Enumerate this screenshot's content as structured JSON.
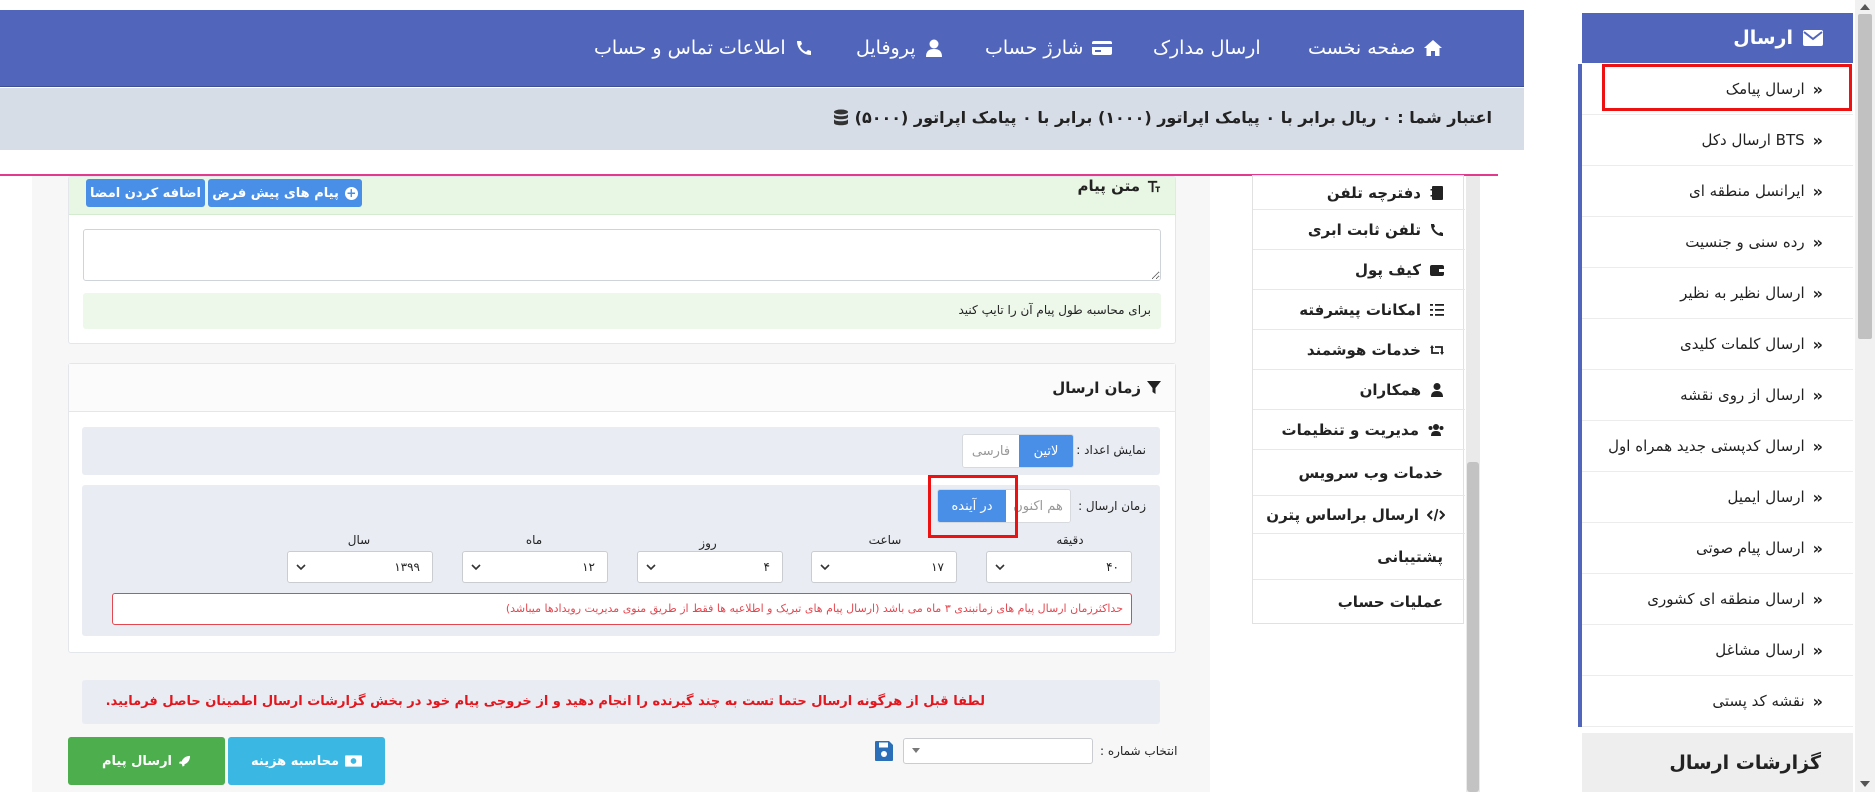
{
  "nav": {
    "home": "صفحه نخست",
    "documents": "ارسال مدارک",
    "charge": "شارژ حساب",
    "profile": "پروفایل",
    "contact": "اطلاعات تماس و حساب"
  },
  "credit": {
    "text": "اعتبار شما : ۰ ریال برابر با ۰ پیامک اپراتور (۱۰۰۰) برابر با ۰ پیامک اپراتور (۵۰۰۰)"
  },
  "message": {
    "title": "متن پیام",
    "default_messages_button": "پیام های پیش فرض",
    "add_signature_button": "اضافه کردن امضا",
    "textarea_value": "",
    "hint": "برای محاسبه طول پیام آن را تایپ کنید"
  },
  "send_time": {
    "title": "زمان ارسال",
    "number_display_label": "نمایش اعداد :",
    "latin": "لاتین",
    "farsi": "فارسی",
    "send_time_label": "زمان ارسال :",
    "now": "هم اکنون",
    "future": "در آینده",
    "fields": {
      "minute": {
        "label": "دقیقه",
        "value": "۴۰"
      },
      "hour": {
        "label": "ساعت",
        "value": "۱۷"
      },
      "day": {
        "label": "روز",
        "value": "۴"
      },
      "month": {
        "label": "ماه",
        "value": "۱۲"
      },
      "year": {
        "label": "سال",
        "value": "۱۳۹۹"
      }
    },
    "warning": "حداکثرزمان ارسال پیام های زمانبندی ۳ ماه می باشد (ارسال پیام های تبریک و اطلاعیه ها فقط از طریق منوی مدیریت رویدادها میباشد)"
  },
  "notice": "لطفا قبل از هرگونه ارسال حتما تست به چند گیرنده را انجام دهید و از خروجی پیام خود در بخش گزارشات ارسال اطمینان حاصل فرمایید.",
  "actions": {
    "select_number_label": "انتخاب شماره :",
    "select_number_value": "",
    "calculate_cost": "محاسبه هزینه",
    "send_message": "ارسال پیام"
  },
  "mid_menu": [
    {
      "label": "دفترچه تلفن",
      "icon": "address-book-icon"
    },
    {
      "label": "تلفن ثابت ابری",
      "icon": "phone-icon"
    },
    {
      "label": "کیف پول",
      "icon": "wallet-icon"
    },
    {
      "label": "امکانات پیشرفته",
      "icon": "list-check-icon"
    },
    {
      "label": "خدمات هوشمند",
      "icon": "retweet-icon"
    },
    {
      "label": "همکاران",
      "icon": "user-tie-icon"
    },
    {
      "label": "مدیریت و تنظیمات",
      "icon": "users-icon"
    },
    {
      "label": "خدمات وب سرویس",
      "icon": ""
    },
    {
      "label": "ارسال براساس پترن",
      "icon": "code-icon"
    },
    {
      "label": "پشتیبانی",
      "icon": ""
    },
    {
      "label": "عملیات حساب",
      "icon": ""
    }
  ],
  "sidebar": {
    "header": "ارسال",
    "items": [
      "ارسال پیامک",
      "ارسال دکل BTS",
      "ایرانسل منطقه ای",
      "رده سنی و جنسیت",
      "ارسال نظیر به نظیر",
      "ارسال کلمات کلیدی",
      "ارسال از روی نقشه",
      "ارسال کدپستی جدید همراه اول",
      "ارسال ایمیل",
      "ارسال پیام صوتی",
      "ارسال منطقه ای کشوری",
      "ارسال مشاغل",
      "نقشه کد پستی"
    ],
    "reports": "گزارشات ارسال",
    "item_marker": "»"
  },
  "colors": {
    "primary": "#5166bb",
    "accent_blue": "#4a8fe7",
    "cyan": "#3ab7e3",
    "green": "#4cae4c",
    "danger": "#e34850",
    "highlight_red": "#ee1111"
  }
}
